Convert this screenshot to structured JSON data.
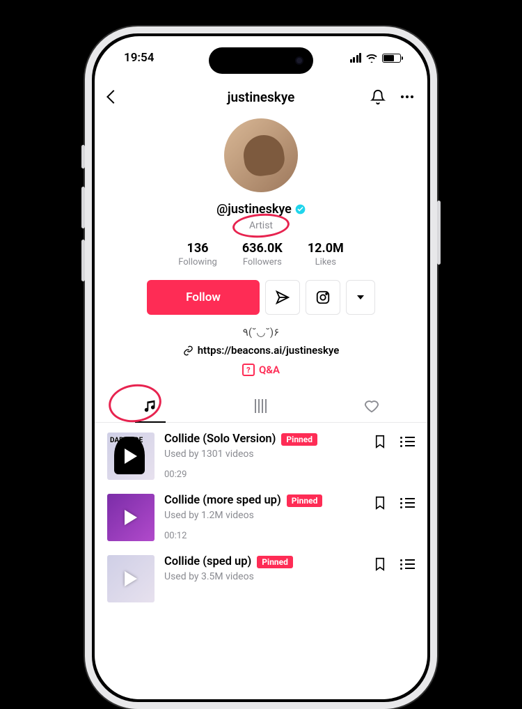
{
  "status": {
    "time": "19:54"
  },
  "nav": {
    "title": "justineskye"
  },
  "profile": {
    "handle": "@justineskye",
    "role": "Artist",
    "bio": "٩(˘◡˘)۶",
    "link": "https://beacons.ai/justineskye",
    "qa": "Q&A"
  },
  "stats": {
    "following_val": "136",
    "following_lbl": "Following",
    "followers_val": "636.0K",
    "followers_lbl": "Followers",
    "likes_val": "12.0M",
    "likes_lbl": "Likes"
  },
  "buttons": {
    "follow": "Follow"
  },
  "badges": {
    "pinned": "Pinned"
  },
  "tracks": [
    {
      "title": "Collide (Solo Version)",
      "used": "Used by 1301 videos",
      "duration": "00:29",
      "pinned": true
    },
    {
      "title": "Collide (more sped up)",
      "used": "Used by 1.2M videos",
      "duration": "00:12",
      "pinned": true
    },
    {
      "title": "Collide (sped up)",
      "used": "Used by 3.5M videos",
      "duration": "",
      "pinned": true
    }
  ],
  "thumb_label": "DARKSIDE"
}
